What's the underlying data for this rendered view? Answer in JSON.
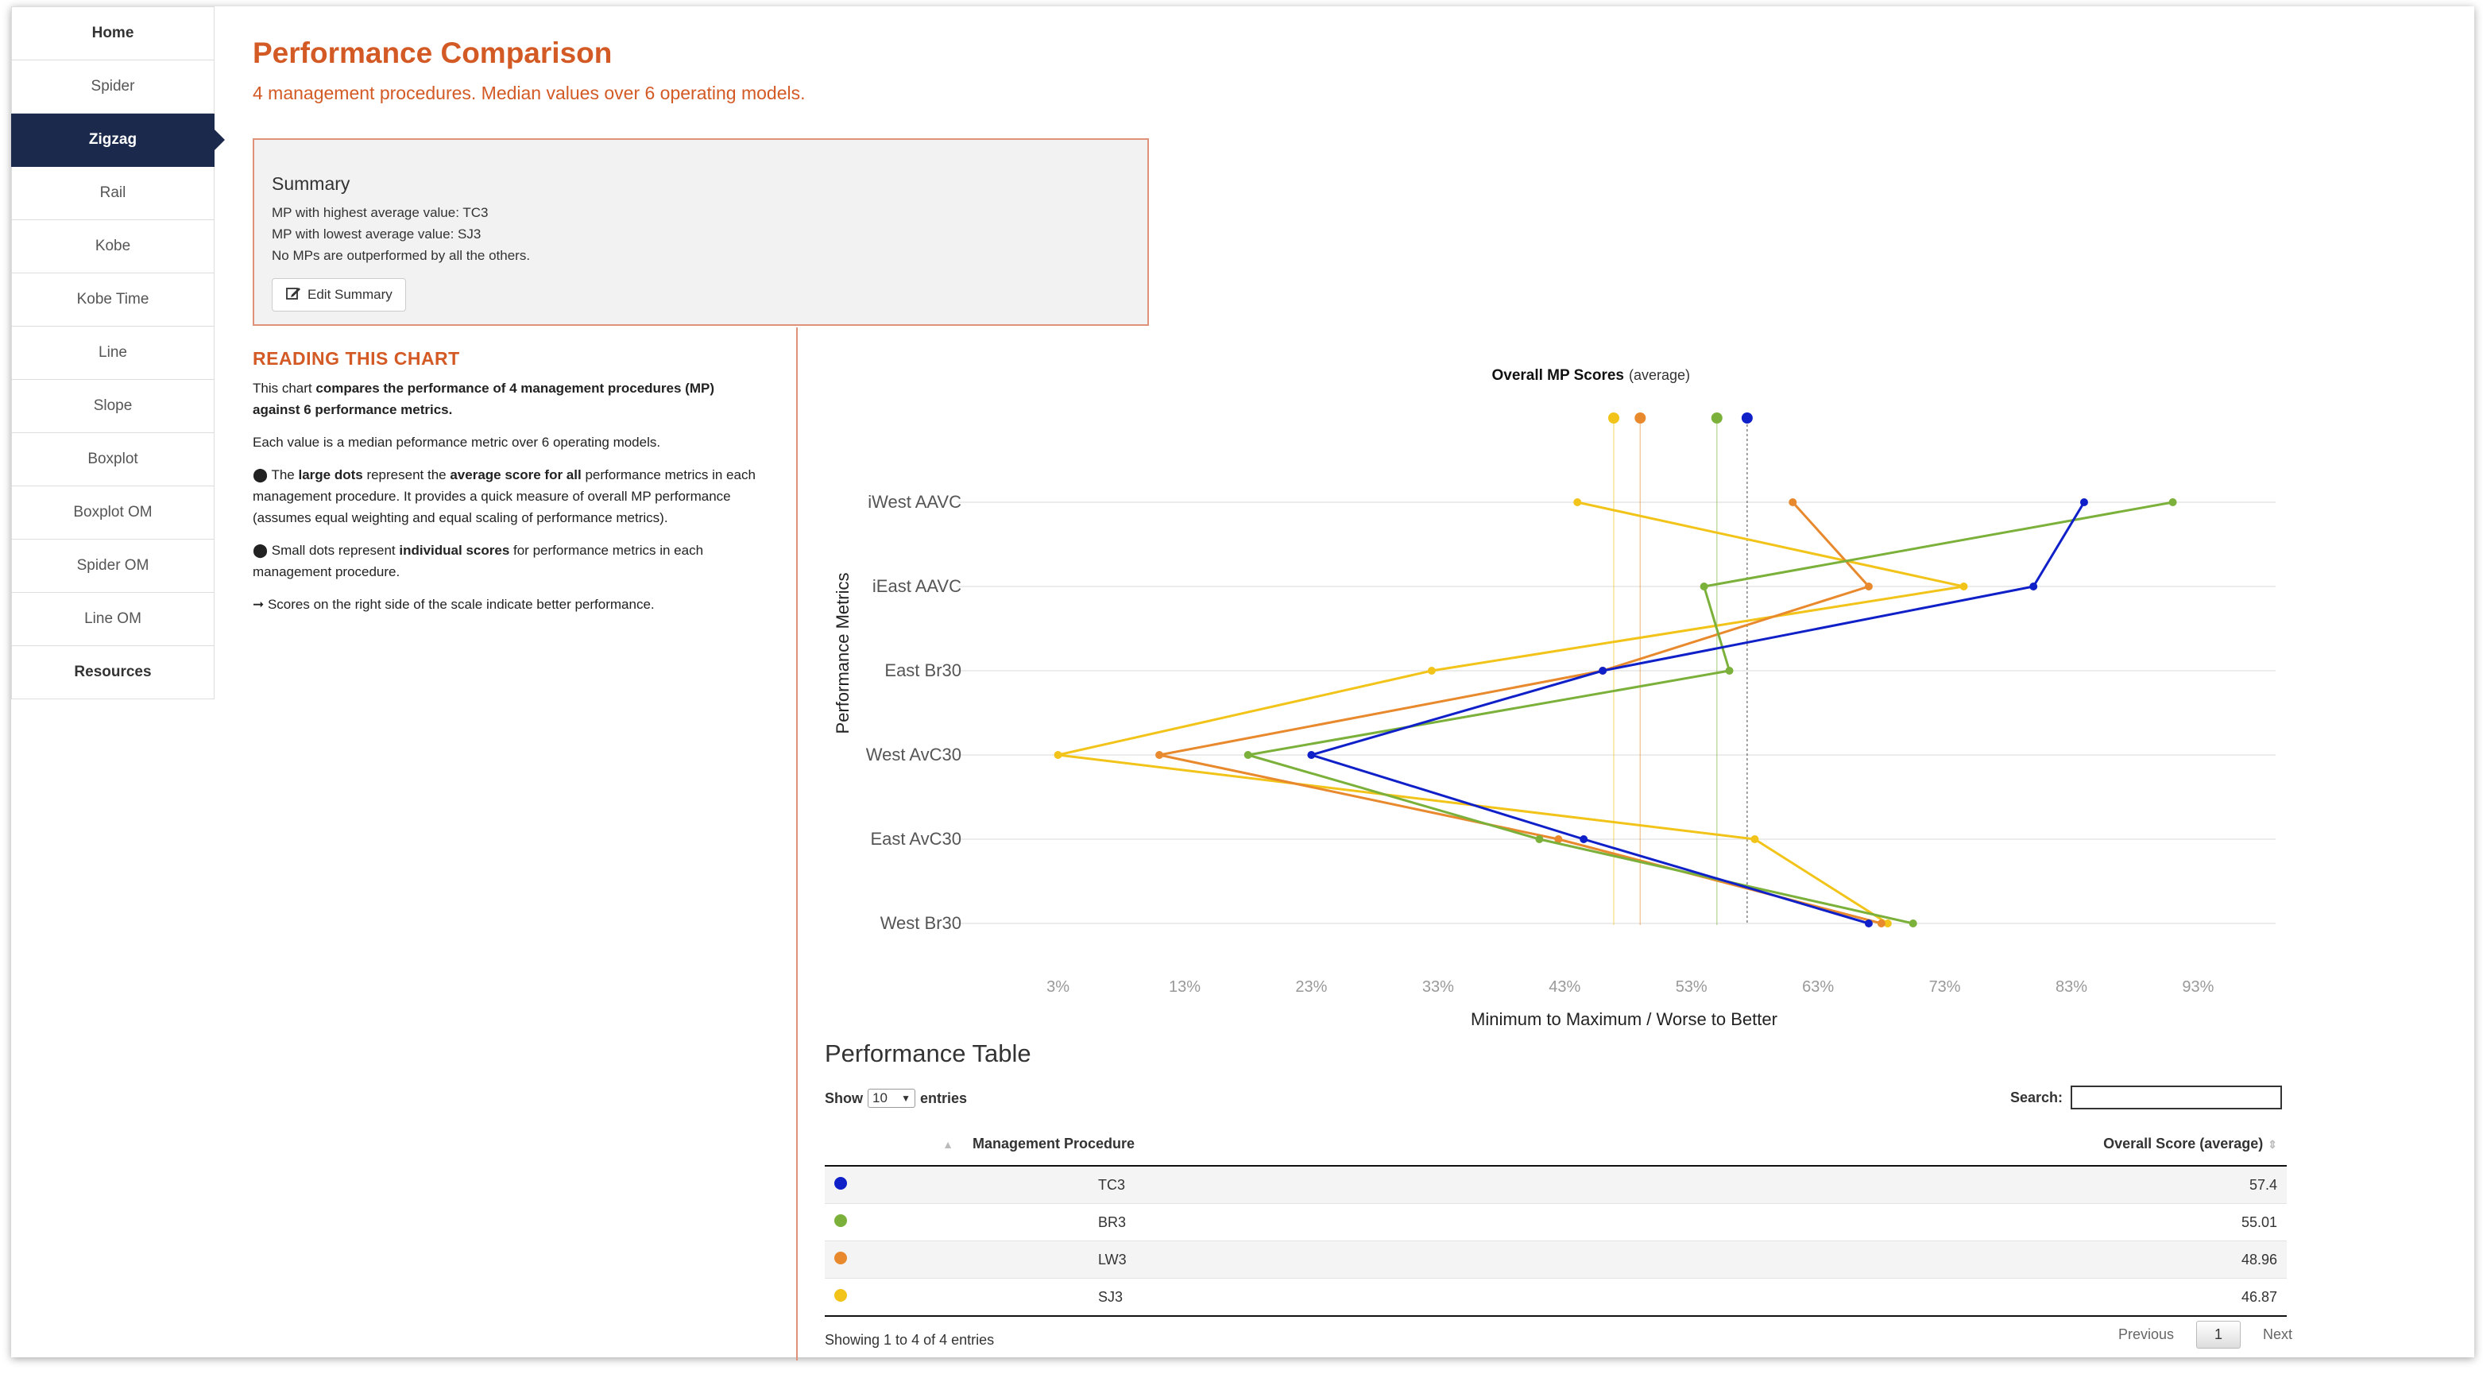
{
  "sidebar": {
    "items": [
      {
        "label": "Home"
      },
      {
        "label": "Spider"
      },
      {
        "label": "Zigzag"
      },
      {
        "label": "Rail"
      },
      {
        "label": "Kobe"
      },
      {
        "label": "Kobe Time"
      },
      {
        "label": "Line"
      },
      {
        "label": "Slope"
      },
      {
        "label": "Boxplot"
      },
      {
        "label": "Boxplot OM"
      },
      {
        "label": "Spider OM"
      },
      {
        "label": "Line OM"
      },
      {
        "label": "Resources"
      }
    ],
    "active": "Zigzag"
  },
  "header": {
    "title": "Performance Comparison",
    "subtitle": "4 management procedures. Median values over 6 operating models."
  },
  "summary": {
    "title": "Summary",
    "lines": [
      "MP with highest average value: TC3",
      "MP with lowest average value: SJ3",
      "No MPs are outperformed by all the others."
    ],
    "edit_label": "Edit Summary"
  },
  "reading": {
    "title": "READING THIS CHART",
    "p1_a": "This chart ",
    "p1_b": "compares the performance of 4 management procedures (MP) against 6 performance metrics.",
    "p2": "Each value is a median peformance metric over 6 operating models.",
    "p3_bullet": "⬤",
    "p3_a": " The ",
    "p3_b": "large dots",
    "p3_c": " represent the ",
    "p3_d": "average score for all",
    "p3_e": " performance metrics in each management procedure. It provides a quick measure of overall MP performance (assumes equal weighting and equal scaling of performance metrics).",
    "p4_bullet": "⬤",
    "p4_a": " Small dots represent ",
    "p4_b": "individual scores",
    "p4_c": " for performance metrics in each management procedure.",
    "p5_arrow": "➞",
    "p5": " Scores on the right side of the scale indicate better performance."
  },
  "chart_data": {
    "type": "line",
    "title": "Overall MP Scores",
    "title_suffix": "(average)",
    "xlabel": "Minimum to Maximum / Worse to Better",
    "ylabel": "Performance Metrics",
    "xlim": [
      -5,
      101
    ],
    "x_ticks": [
      "3%",
      "13%",
      "23%",
      "33%",
      "43%",
      "53%",
      "63%",
      "73%",
      "83%",
      "93%"
    ],
    "x_tick_values": [
      3,
      13,
      23,
      33,
      43,
      53,
      63,
      73,
      83,
      93
    ],
    "categories": [
      "iWest AAVC",
      "iEast AAVC",
      "East Br30",
      "West AvC30",
      "East AvC30",
      "West Br30"
    ],
    "grid": true,
    "series": [
      {
        "name": "TC3",
        "color": "#1020c8",
        "average": 57.4,
        "values": [
          84,
          80,
          46,
          23,
          44.5,
          67
        ]
      },
      {
        "name": "BR3",
        "color": "#7bb13a",
        "average": 55.01,
        "values": [
          91,
          54,
          56,
          18,
          41,
          70.5
        ]
      },
      {
        "name": "LW3",
        "color": "#e8892d",
        "average": 48.96,
        "values": [
          61,
          67,
          46,
          11,
          42.5,
          68
        ]
      },
      {
        "name": "SJ3",
        "color": "#f2c419",
        "average": 46.87,
        "values": [
          44,
          74.5,
          32.5,
          3,
          58,
          68.5
        ]
      }
    ]
  },
  "table": {
    "title": "Performance Table",
    "show_label": "Show",
    "show_value": "10",
    "entries_label": "entries",
    "search_label": "Search:",
    "search_value": "",
    "columns": [
      "",
      "Management Procedure",
      "Overall Score (average)"
    ],
    "rows": [
      {
        "color": "#1020c8",
        "mp": "TC3",
        "score": "57.4"
      },
      {
        "color": "#7bb13a",
        "mp": "BR3",
        "score": "55.01"
      },
      {
        "color": "#e8892d",
        "mp": "LW3",
        "score": "48.96"
      },
      {
        "color": "#f2c419",
        "mp": "SJ3",
        "score": "46.87"
      }
    ],
    "info": "Showing 1 to 4 of 4 entries",
    "prev_label": "Previous",
    "page": "1",
    "next_label": "Next"
  }
}
